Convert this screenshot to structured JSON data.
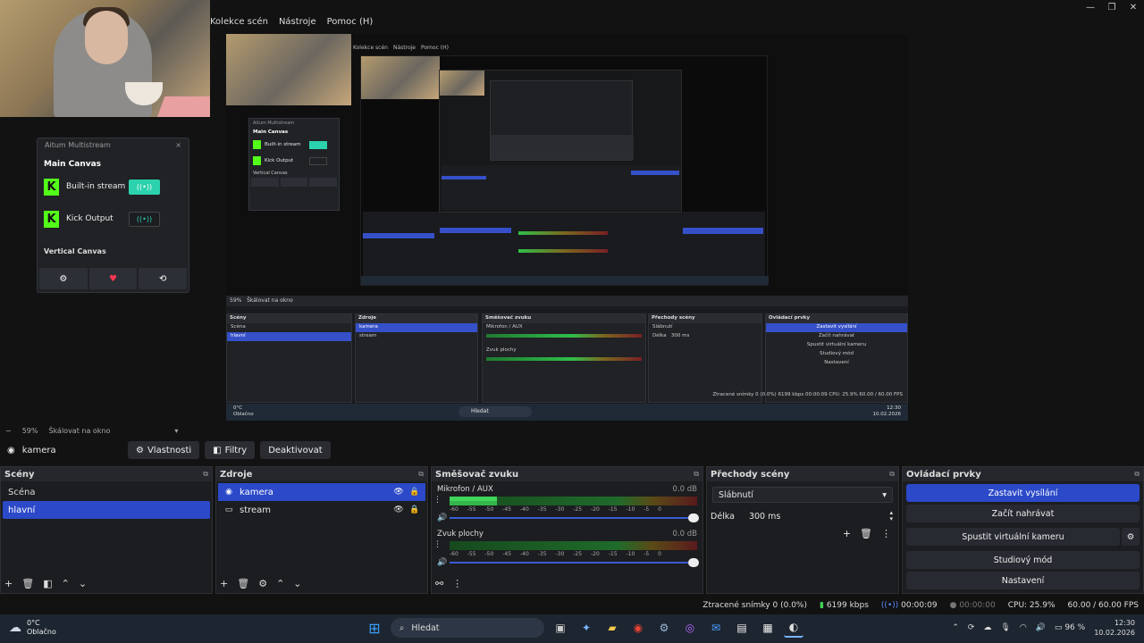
{
  "menu": [
    "Kolekce scén",
    "Nástroje",
    "Pomoc (H)"
  ],
  "window_controls": [
    "—",
    "❐",
    "✕"
  ],
  "dock": {
    "title": "Aitum Multistream",
    "close": "×",
    "main_canvas": "Main Canvas",
    "outputs": [
      {
        "label": "Built-in stream",
        "active": true
      },
      {
        "label": "Kick Output",
        "active": false
      }
    ],
    "vertical_canvas": "Vertical Canvas",
    "stream_glyph": "((•))"
  },
  "preview": {
    "menu": [
      "Kolekce scén",
      "Nástroje",
      "Pomoc (H)"
    ],
    "inner_dock_title": "Aitum Multistream",
    "inner_main_canvas": "Main Canvas",
    "inner_outputs": [
      "Built-in stream",
      "Kick Output"
    ],
    "inner_vertical": "Vertical Canvas",
    "scale": "59%",
    "scale_mode": "Škálovat na okno",
    "source": "kamera",
    "btns": [
      "Vlastnosti",
      "Filtry",
      "Deaktivovat"
    ],
    "panels": [
      "Scény",
      "Zdroje",
      "Směšovač zvuku",
      "Přechody scény",
      "Ovládací prvky"
    ],
    "scenes": [
      "Scéna",
      "hlavní"
    ],
    "sources": [
      "kamera",
      "stream"
    ],
    "mixer": [
      "Mikrofon / AUX",
      "Zvuk plochy"
    ],
    "transition": "Slábnutí",
    "duration_label": "Délka",
    "duration": "300 ms",
    "controls": [
      "Zastavit vysílání",
      "Začít nahrávat",
      "Spustit virtuální kameru",
      "Studiový mód",
      "Nastavení"
    ],
    "status": "Ztracené snímky 0 (0.0%)   6199 kbps   00:00:09   CPU: 25.9%   60.00 / 60.00 FPS",
    "search": "Hledat",
    "weather": "0°C",
    "weather_desc": "Oblačno",
    "time": "12:30",
    "date": "10.02.2026"
  },
  "scalebar": {
    "zoom": "59%",
    "mode": "Škálovat na okno"
  },
  "source_toolbar": {
    "source_name": "kamera",
    "properties": "Vlastnosti",
    "filters": "Filtry",
    "deactivate": "Deaktivovat"
  },
  "scenes": {
    "title": "Scény",
    "items": [
      {
        "label": "Scéna",
        "selected": false
      },
      {
        "label": "hlavní",
        "selected": true
      }
    ]
  },
  "sources": {
    "title": "Zdroje",
    "items": [
      {
        "label": "kamera",
        "selected": true
      },
      {
        "label": "stream",
        "selected": false
      }
    ]
  },
  "mixer": {
    "title": "Směšovač zvuku",
    "ticks": [
      "-60",
      "-55",
      "-50",
      "-45",
      "-40",
      "-35",
      "-30",
      "-25",
      "-20",
      "-15",
      "-10",
      "-5",
      "0"
    ],
    "channels": [
      {
        "name": "Mikrofon / AUX",
        "db": "0.0 dB",
        "level": 0.19
      },
      {
        "name": "Zvuk plochy",
        "db": "0.0 dB",
        "level": 0.0
      }
    ]
  },
  "transitions": {
    "title": "Přechody scény",
    "selected": "Slábnutí",
    "duration_label": "Délka",
    "duration": "300 ms"
  },
  "controls": {
    "title": "Ovládací prvky",
    "stop_stream": "Zastavit vysílání",
    "start_recording": "Začít nahrávat",
    "start_virtual_cam": "Spustit virtuální kameru",
    "studio_mode": "Studiový mód",
    "settings": "Nastavení"
  },
  "status": {
    "dropped": "Ztracené snímky 0 (0.0%)",
    "bitrate": "6199 kbps",
    "stream_time": "00:00:09",
    "rec_time": "00:00:00",
    "cpu": "CPU: 25.9%",
    "fps": "60.00 / 60.00 FPS"
  },
  "taskbar": {
    "weather_temp": "0°C",
    "weather_desc": "Oblačno",
    "search": "Hledat",
    "battery": "96 %",
    "time": "12:30",
    "date": "10.02.2026"
  },
  "colors": {
    "accent": "#2b49c8",
    "kick": "#53fc18",
    "stream_on": "#2bd2ad"
  }
}
